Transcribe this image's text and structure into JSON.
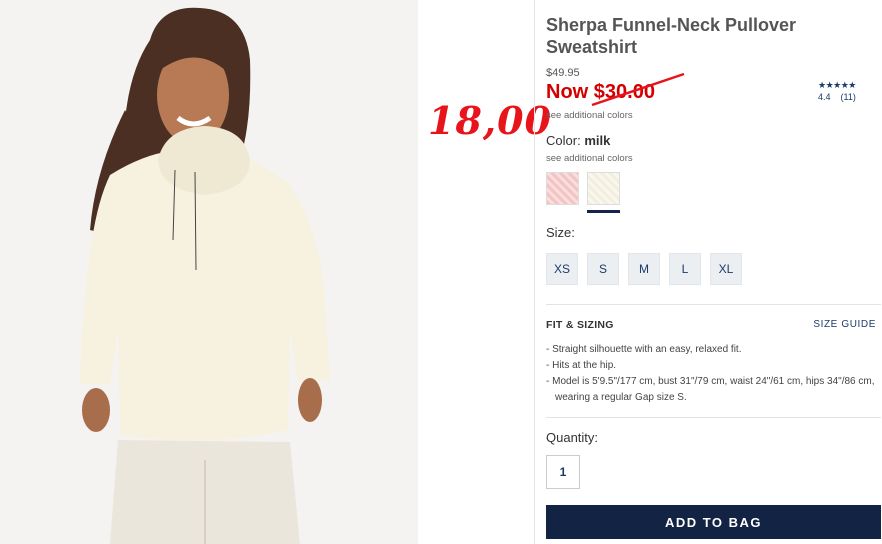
{
  "product": {
    "title": "Sherpa Funnel-Neck Pullover Sweatshirt",
    "original_price": "$49.95",
    "sale_label": "Now $30.00",
    "see_additional_colors": "see additional colors",
    "handwritten_price": "18,00"
  },
  "rating": {
    "stars": "★★★★★",
    "score": "4.4",
    "count": "(11)"
  },
  "color": {
    "label": "Color:",
    "selected": "milk",
    "swatches": [
      {
        "name": "pink",
        "color": "#f4c4c4"
      },
      {
        "name": "milk",
        "color": "#f2efdf"
      }
    ]
  },
  "size": {
    "label": "Size:",
    "options": [
      "XS",
      "S",
      "M",
      "L",
      "XL"
    ]
  },
  "fit": {
    "title": "FIT & SIZING",
    "size_guide": "SIZE GUIDE",
    "bullets": [
      "Straight silhouette with an easy, relaxed fit.",
      "Hits at the hip.",
      "Model is 5'9.5\"/177 cm, bust 31\"/79 cm, waist 24\"/61 cm, hips 34\"/86 cm, wearing a regular Gap size S."
    ]
  },
  "quantity": {
    "label": "Quantity:",
    "value": "1"
  },
  "cta": {
    "add_to_bag": "ADD TO BAG"
  },
  "colors": {
    "sale_red": "#d40000",
    "navy": "#122344",
    "link_blue": "#1b3a6b"
  }
}
